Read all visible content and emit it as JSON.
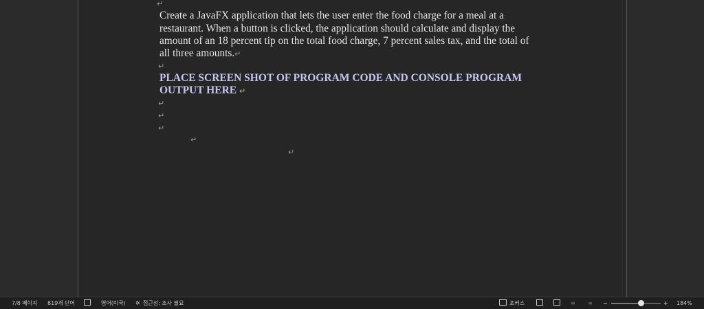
{
  "document": {
    "top_mark": "↵",
    "paragraph": [
      "Create a JavaFX application that lets the user enter the food charge for a meal at a",
      "restaurant. When a button is clicked, the application should calculate and display the",
      "amount of an 18 percent tip on the total food charge, 7 percent sales tax, and the total of",
      "all three amounts."
    ],
    "heading": [
      "PLACE SCREEN SHOT OF PROGRAM CODE AND CONSOLE PROGRAM",
      "OUTPUT HERE"
    ],
    "paragraph_mark": "↵"
  },
  "status_bar": {
    "page": "7/8 페이지",
    "words": "819개 단어",
    "language": "영어(미국)",
    "accessibility": "접근성: 조사 필요",
    "focus": "포커스",
    "zoom_label": "184%",
    "zoom_minus": "−",
    "zoom_plus": "+",
    "zoom_fraction": 0.6
  }
}
